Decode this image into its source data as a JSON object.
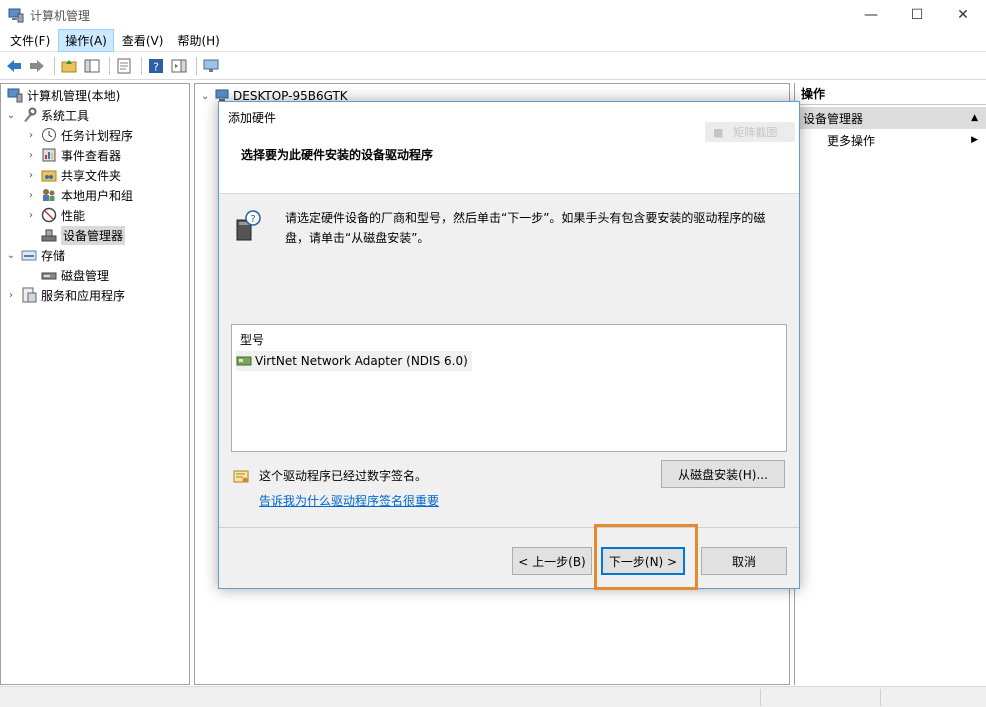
{
  "window": {
    "title": "计算机管理",
    "controls": [
      "minimize-icon",
      "maximize-icon",
      "close-icon"
    ]
  },
  "menu": {
    "items": [
      "文件(F)",
      "操作(A)",
      "查看(V)",
      "帮助(H)"
    ],
    "active_index": 1
  },
  "tree": {
    "root": "计算机管理(本地)",
    "system_tools": "系统工具",
    "task_scheduler": "任务计划程序",
    "event_viewer": "事件查看器",
    "shared_folders": "共享文件夹",
    "local_users": "本地用户和组",
    "performance": "性能",
    "device_manager": "设备管理器",
    "storage": "存储",
    "disk_management": "磁盘管理",
    "services_apps": "服务和应用程序"
  },
  "middle": {
    "computer_name": "DESKTOP-95B6GTK"
  },
  "actions": {
    "header": "操作",
    "section": "设备管理器",
    "more": "更多操作"
  },
  "dialog": {
    "title": "添加硬件",
    "heading": "选择要为此硬件安装的设备驱动程序",
    "ghost_text": "矩阵截图",
    "info": "请选定硬件设备的厂商和型号，然后单击“下一步”。如果手头有包含要安装的驱动程序的磁盘，请单击“从磁盘安装”。",
    "model_header": "型号",
    "model_item": "VirtNet Network Adapter (NDIS 6.0)",
    "signature_text": "这个驱动程序已经过数字签名。",
    "signature_link": "告诉我为什么驱动程序签名很重要",
    "have_disk": "从磁盘安装(H)...",
    "back": "< 上一步(B)",
    "next": "下一步(N) >",
    "cancel": "取消"
  },
  "colors": {
    "accent": "#0078d7",
    "highlight": "#e48a32",
    "link": "#0066cc"
  }
}
